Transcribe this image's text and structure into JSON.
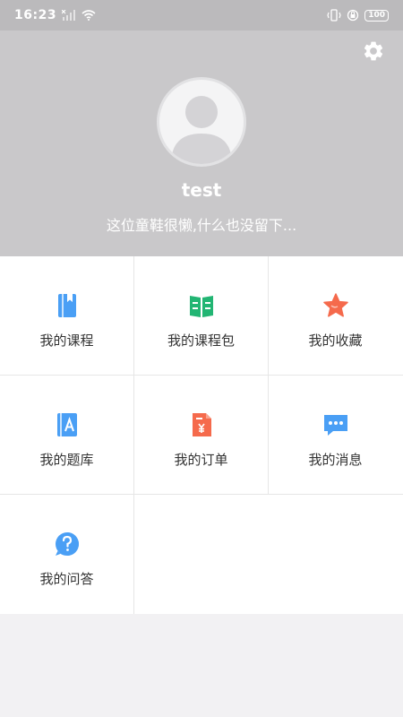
{
  "status_bar": {
    "time": "16:23",
    "battery": "100"
  },
  "profile": {
    "username": "test",
    "bio": "这位童鞋很懒,什么也没留下..."
  },
  "menu": {
    "items": [
      {
        "label": "我的课程",
        "icon": "course-book-icon",
        "color": "#4a9ff5"
      },
      {
        "label": "我的课程包",
        "icon": "course-package-icon",
        "color": "#22b573"
      },
      {
        "label": "我的收藏",
        "icon": "star-icon",
        "color": "#f56a4c"
      },
      {
        "label": "我的题库",
        "icon": "question-bank-icon",
        "color": "#4a9ff5"
      },
      {
        "label": "我的订单",
        "icon": "order-icon",
        "color": "#f56a4c"
      },
      {
        "label": "我的消息",
        "icon": "message-icon",
        "color": "#4a9ff5"
      },
      {
        "label": "我的问答",
        "icon": "qa-icon",
        "color": "#4a9ff5"
      }
    ]
  }
}
